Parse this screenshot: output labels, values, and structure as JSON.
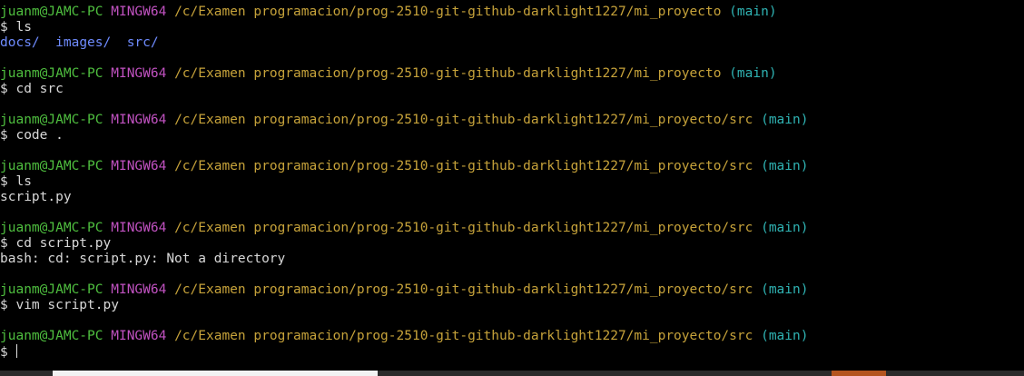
{
  "terminal": {
    "lines": [
      {
        "type": "prompt",
        "user": "juanm@JAMC-PC",
        "env": "MINGW64",
        "path": "/c/Examen programacion/prog-2510-git-github-darklight1227/mi_proyecto",
        "branch": "(main)"
      },
      {
        "type": "cmd",
        "text": "$ ls"
      },
      {
        "type": "dirs",
        "items": [
          "docs/",
          "images/",
          "src/"
        ]
      },
      {
        "type": "blank"
      },
      {
        "type": "prompt",
        "user": "juanm@JAMC-PC",
        "env": "MINGW64",
        "path": "/c/Examen programacion/prog-2510-git-github-darklight1227/mi_proyecto",
        "branch": "(main)"
      },
      {
        "type": "cmd",
        "text": "$ cd src"
      },
      {
        "type": "blank"
      },
      {
        "type": "prompt",
        "user": "juanm@JAMC-PC",
        "env": "MINGW64",
        "path": "/c/Examen programacion/prog-2510-git-github-darklight1227/mi_proyecto/src",
        "branch": "(main)"
      },
      {
        "type": "cmd",
        "text": "$ code ."
      },
      {
        "type": "blank"
      },
      {
        "type": "prompt",
        "user": "juanm@JAMC-PC",
        "env": "MINGW64",
        "path": "/c/Examen programacion/prog-2510-git-github-darklight1227/mi_proyecto/src",
        "branch": "(main)"
      },
      {
        "type": "cmd",
        "text": "$ ls"
      },
      {
        "type": "out",
        "text": "script.py"
      },
      {
        "type": "blank"
      },
      {
        "type": "prompt",
        "user": "juanm@JAMC-PC",
        "env": "MINGW64",
        "path": "/c/Examen programacion/prog-2510-git-github-darklight1227/mi_proyecto/src",
        "branch": "(main)"
      },
      {
        "type": "cmd",
        "text": "$ cd script.py"
      },
      {
        "type": "out",
        "text": "bash: cd: script.py: Not a directory"
      },
      {
        "type": "blank"
      },
      {
        "type": "prompt",
        "user": "juanm@JAMC-PC",
        "env": "MINGW64",
        "path": "/c/Examen programacion/prog-2510-git-github-darklight1227/mi_proyecto/src",
        "branch": "(main)"
      },
      {
        "type": "cmd",
        "text": "$ vim script.py"
      },
      {
        "type": "blank"
      },
      {
        "type": "prompt",
        "user": "juanm@JAMC-PC",
        "env": "MINGW64",
        "path": "/c/Examen programacion/prog-2510-git-github-darklight1227/mi_proyecto/src",
        "branch": "(main)"
      },
      {
        "type": "input",
        "text": "$ "
      }
    ]
  },
  "colors": {
    "background": "#000000",
    "user": "#4fbf3f",
    "env": "#c152c1",
    "path": "#c6a23a",
    "branch": "#2fb3b3",
    "dir": "#6f8cff",
    "text": "#d8d8d8"
  }
}
